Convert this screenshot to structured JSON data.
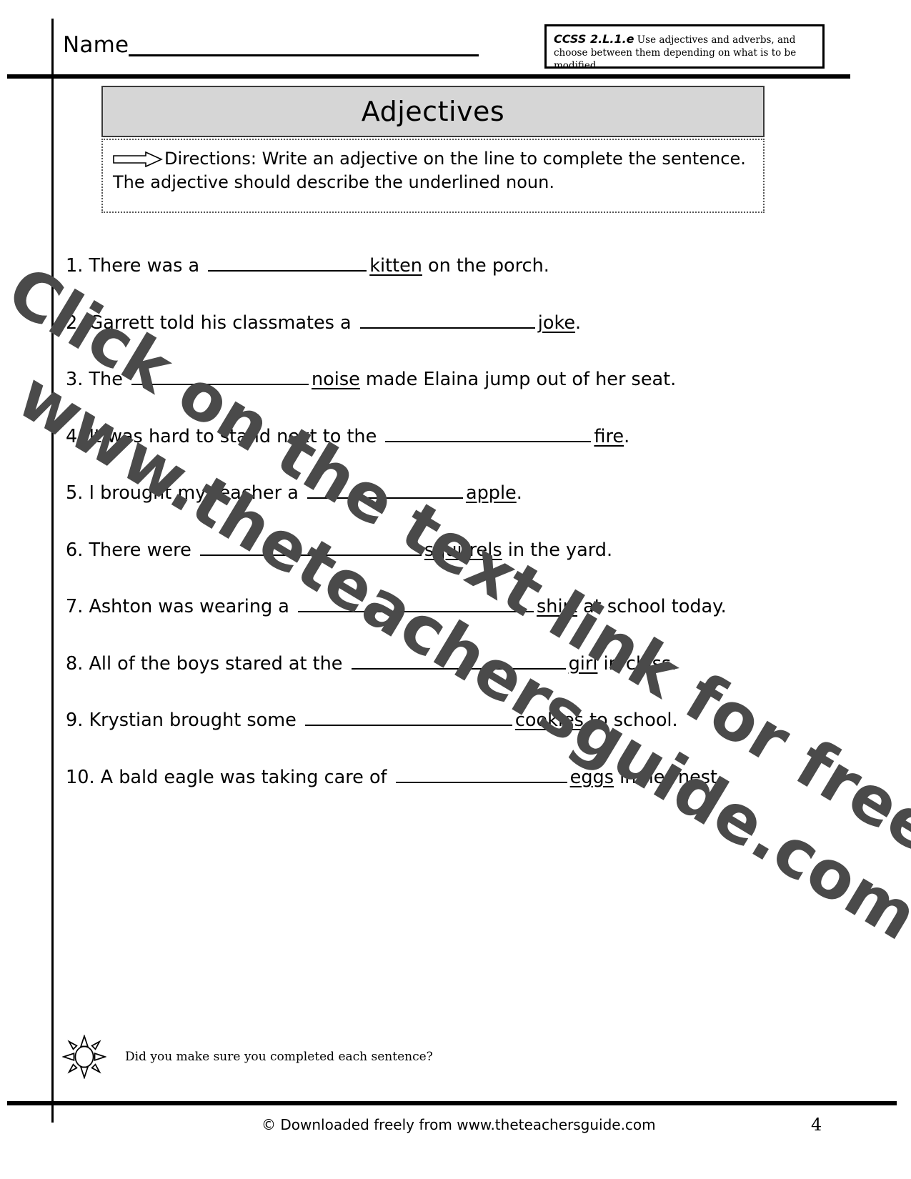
{
  "header": {
    "name_label": "Name",
    "ccss_code": "CCSS 2.L.1.e",
    "ccss_description": " Use adjectives and adverbs, and choose between them depending on what is to be modified."
  },
  "title": "Adjectives",
  "directions": {
    "icon": "arrow-right-icon",
    "text": "Directions: Write an adjective on the line to complete the sentence.  The adjective should describe the underlined noun."
  },
  "questions": [
    {
      "number": "1.",
      "before": "There was a",
      "blank_width": 222,
      "noun": "kitten",
      "after": "on the porch."
    },
    {
      "number": "2.",
      "before": "Garrett told his classmates a",
      "blank_width": 245,
      "noun": "joke",
      "after": "."
    },
    {
      "number": "3.",
      "before": "The",
      "blank_width": 248,
      "noun": "noise",
      "after": "made Elaina jump out of her seat."
    },
    {
      "number": "4.",
      "before": "It was hard to stand next to the",
      "blank_width": 288,
      "noun": "fire",
      "after": "."
    },
    {
      "number": "5.",
      "before": "I brought my teacher a",
      "blank_width": 218,
      "noun": "apple",
      "after": "."
    },
    {
      "number": "6.",
      "before": "There were",
      "blank_width": 310,
      "noun": "squirrels",
      "after": "in the yard."
    },
    {
      "number": "7.",
      "before": "Ashton was wearing a",
      "blank_width": 330,
      "noun": "shirt",
      "after": "at school today."
    },
    {
      "number": "8.",
      "before": "All of the boys stared at the",
      "blank_width": 300,
      "noun": "girl",
      "after": "in class."
    },
    {
      "number": "9.",
      "before": "Krystian brought some",
      "blank_width": 290,
      "noun": "cookies",
      "after": "to school."
    },
    {
      "number": "10.",
      "before": "A bald eagle was taking care of",
      "blank_width": 240,
      "noun": "eggs",
      "after": "in her nest."
    }
  ],
  "watermark": {
    "line1": "Click on the text link for free PDF",
    "line2": "www.theteachersguide.com",
    "color": "#4a4a4a"
  },
  "check_reminder": {
    "icon": "sun-icon",
    "text": "Did you make sure you completed each sentence?"
  },
  "footer": {
    "credit": "© Downloaded freely from www.theteachersguide.com",
    "page_number": "4"
  },
  "colors": {
    "title_bar_bg": "#d6d6d6",
    "rule": "#000000",
    "watermark": "#4a4a4a"
  }
}
